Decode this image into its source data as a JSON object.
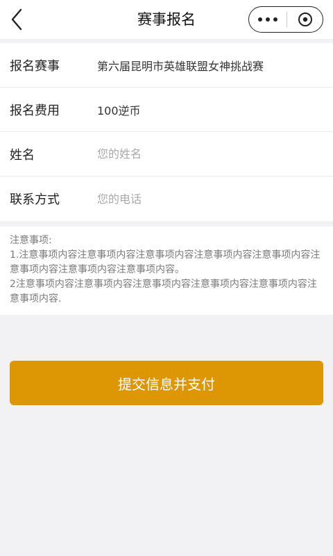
{
  "header": {
    "title": "赛事报名",
    "back_icon": "chevron-left-icon",
    "more_icon": "more-dots-icon",
    "close_icon": "target-close-icon"
  },
  "form": {
    "event": {
      "label": "报名赛事",
      "value": "第六届昆明市英雄联盟女神挑战赛"
    },
    "fee": {
      "label": "报名费用",
      "value": "100逆币"
    },
    "name": {
      "label": "姓名",
      "placeholder": "您的姓名",
      "value": ""
    },
    "phone": {
      "label": "联系方式",
      "placeholder": "您的电话",
      "value": ""
    }
  },
  "notice": {
    "title": "注意事项:",
    "item1": "1.注意事项内容注意事项内容注意事项内容注意事项内容注意事项内容注意事项内容注意事项内容注意事项内容。",
    "item2": "2注意事项内容注意事项内容注意事项内容注意事项内容注意事项内容注意事项内容."
  },
  "submit_label": "提交信息并支付",
  "colors": {
    "accent": "#de9704",
    "background": "#f2f2f4"
  }
}
